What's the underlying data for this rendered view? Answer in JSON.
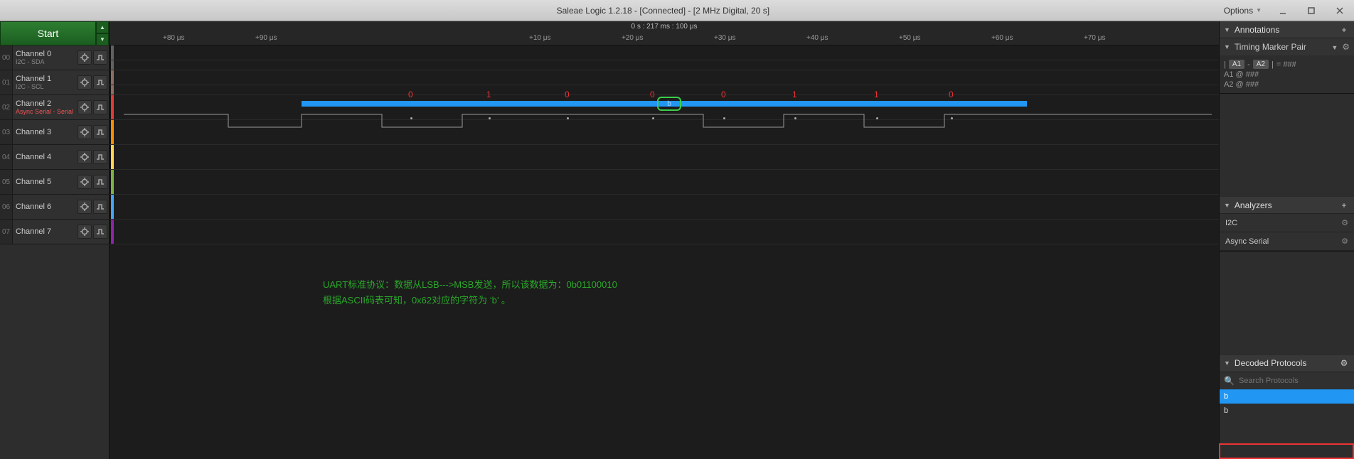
{
  "titlebar": {
    "title": "Saleae Logic 1.2.18 - [Connected] - [2 MHz Digital, 20 s]",
    "options": "Options"
  },
  "start": {
    "label": "Start"
  },
  "channels": [
    {
      "num": "00",
      "name": "Channel 0",
      "sub": "I2C - SDA",
      "subRed": false,
      "color": "ch-colors-0"
    },
    {
      "num": "01",
      "name": "Channel 1",
      "sub": "I2C - SCL",
      "subRed": false,
      "color": "ch-colors-1"
    },
    {
      "num": "02",
      "name": "Channel 2",
      "sub": "Async Serial - Serial",
      "subRed": true,
      "color": "ch-colors-2"
    },
    {
      "num": "03",
      "name": "Channel 3",
      "sub": "",
      "subRed": false,
      "color": "ch-colors-3"
    },
    {
      "num": "04",
      "name": "Channel 4",
      "sub": "",
      "subRed": false,
      "color": "ch-colors-4"
    },
    {
      "num": "05",
      "name": "Channel 5",
      "sub": "",
      "subRed": false,
      "color": "ch-colors-5"
    },
    {
      "num": "06",
      "name": "Channel 6",
      "sub": "",
      "subRed": false,
      "color": "ch-colors-6"
    },
    {
      "num": "07",
      "name": "Channel 7",
      "sub": "",
      "subRed": false,
      "color": "ch-colors-7"
    }
  ],
  "timeline": {
    "center": "0 s : 217 ms : 100 μs",
    "ticks": [
      "+80 μs",
      "+90 μs",
      "",
      "+10 μs",
      "+20 μs",
      "+30 μs",
      "+40 μs",
      "+50 μs",
      "+60 μs",
      "+70 μs"
    ]
  },
  "bits": [
    "0",
    "1",
    "0",
    "0",
    "0",
    "1",
    "1",
    "0"
  ],
  "decode": {
    "char": "b"
  },
  "note": {
    "line1": "UART标准协议：数据从LSB--->MSB发送，所以该数据为：0b01100010",
    "line2": "根据ASCII码表可知，0x62对应的字符为 ‘b’ 。"
  },
  "annotations": {
    "header": "Annotations",
    "timing_header": "Timing Marker Pair",
    "pair_label_a1": "A1",
    "pair_label_a2": "A2",
    "pair_eq": " = ###",
    "a1": "A1  @  ###",
    "a2": "A2  @  ###"
  },
  "analyzers": {
    "header": "Analyzers",
    "items": [
      "I2C",
      "Async Serial"
    ]
  },
  "decoded": {
    "header": "Decoded Protocols",
    "search_placeholder": "Search Protocols",
    "items": [
      "b",
      "b"
    ]
  }
}
